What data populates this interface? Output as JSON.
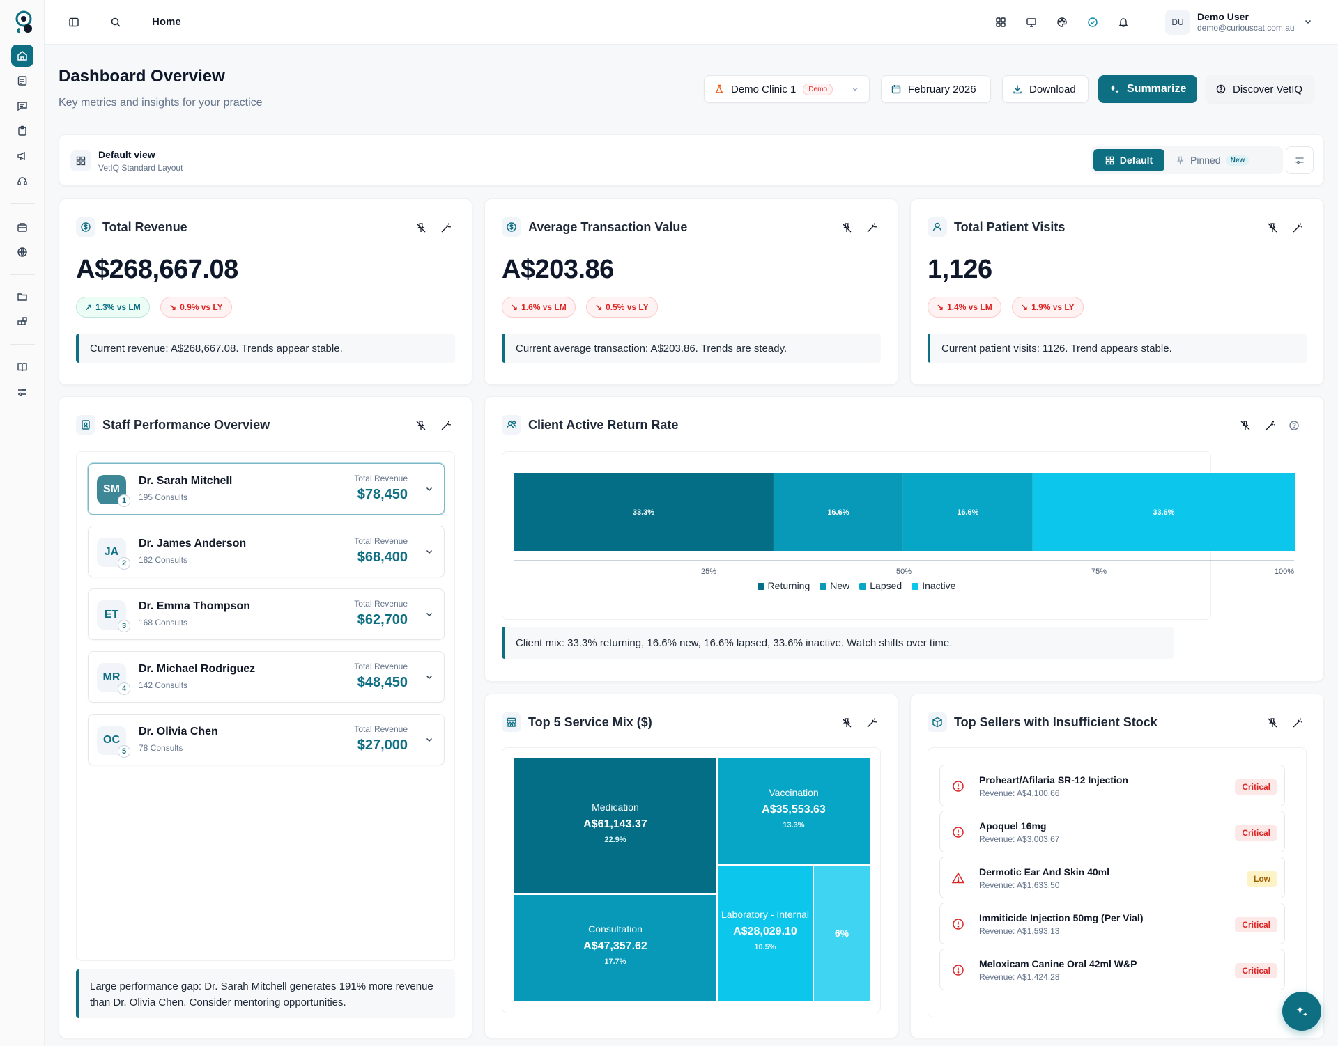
{
  "topbar": {
    "breadcrumb": "Home",
    "user": {
      "initials": "DU",
      "name": "Demo User",
      "email": "demo@curiouscat.com.au"
    }
  },
  "header": {
    "title": "Dashboard Overview",
    "subtitle": "Key metrics and insights for your practice",
    "clinic": "Demo Clinic 1",
    "clinic_badge": "Demo",
    "period": "February 2026",
    "download": "Download",
    "summarize": "Summarize",
    "discover": "Discover VetIQ"
  },
  "view": {
    "title": "Default view",
    "subtitle": "VetIQ Standard Layout",
    "default_label": "Default",
    "pinned_label": "Pinned",
    "new_badge": "New"
  },
  "kpis": [
    {
      "title": "Total Revenue",
      "value": "A$268,667.08",
      "pill1": "1.3% vs LM",
      "pill1_dir": "up",
      "pill2": "0.9% vs LY",
      "pill2_dir": "down",
      "insight": "Current revenue: A$268,667.08. Trends appear stable."
    },
    {
      "title": "Average Transaction Value",
      "value": "A$203.86",
      "pill1": "1.6% vs LM",
      "pill1_dir": "down",
      "pill2": "0.5% vs LY",
      "pill2_dir": "down",
      "insight": "Current average transaction: A$203.86. Trends are steady."
    },
    {
      "title": "Total Patient Visits",
      "value": "1,126",
      "pill1": "1.4% vs LM",
      "pill1_dir": "down",
      "pill2": "1.9% vs LY",
      "pill2_dir": "down",
      "insight": "Current patient visits: 1126. Trend appears stable."
    }
  ],
  "staff": {
    "title": "Staff Performance Overview",
    "revenue_label": "Total Revenue",
    "rows": [
      {
        "initials": "SM",
        "rank": "1",
        "name": "Dr. Sarah Mitchell",
        "consults": "195 Consults",
        "revenue": "$78,450"
      },
      {
        "initials": "JA",
        "rank": "2",
        "name": "Dr. James Anderson",
        "consults": "182 Consults",
        "revenue": "$68,400"
      },
      {
        "initials": "ET",
        "rank": "3",
        "name": "Dr. Emma Thompson",
        "consults": "168 Consults",
        "revenue": "$62,700"
      },
      {
        "initials": "MR",
        "rank": "4",
        "name": "Dr. Michael Rodriguez",
        "consults": "142 Consults",
        "revenue": "$48,450"
      },
      {
        "initials": "OC",
        "rank": "5",
        "name": "Dr. Olivia Chen",
        "consults": "78 Consults",
        "revenue": "$27,000"
      }
    ],
    "insight": "Large performance gap: Dr. Sarah Mitchell generates 191% more revenue than Dr. Olivia Chen. Consider mentoring opportunities."
  },
  "client_rate": {
    "title": "Client Active Return Rate",
    "insight": "Client mix: 33.3% returning, 16.6% new, 16.6% lapsed, 33.6% inactive. Watch shifts over time."
  },
  "service_mix": {
    "title": "Top 5 Service Mix ($)",
    "tiles": [
      {
        "name": "Medication",
        "amount": "A$61,143.37",
        "pct": "22.9%"
      },
      {
        "name": "Vaccination",
        "amount": "A$35,553.63",
        "pct": "13.3%"
      },
      {
        "name": "Consultation",
        "amount": "A$47,357.62",
        "pct": "17.7%"
      },
      {
        "name": "Laboratory - Internal",
        "amount": "A$28,029.10",
        "pct": "10.5%"
      },
      {
        "name": "",
        "amount": "",
        "pct": "6%"
      }
    ]
  },
  "stock": {
    "title": "Top Sellers with Insufficient Stock",
    "items": [
      {
        "name": "Proheart/Afilaria SR-12 Injection",
        "revenue": "Revenue: A$4,100.66",
        "status": "Critical",
        "level": "critical"
      },
      {
        "name": "Apoquel 16mg",
        "revenue": "Revenue: A$3,003.67",
        "status": "Critical",
        "level": "critical"
      },
      {
        "name": "Dermotic Ear And Skin 40ml",
        "revenue": "Revenue: A$1,633.50",
        "status": "Low",
        "level": "low"
      },
      {
        "name": "Immiticide Injection 50mg (Per Vial)",
        "revenue": "Revenue: A$1,593.13",
        "status": "Critical",
        "level": "critical"
      },
      {
        "name": "Meloxicam Canine Oral 42ml W&P",
        "revenue": "Revenue: A$1,424.28",
        "status": "Critical",
        "level": "critical"
      }
    ]
  },
  "colors": {
    "brand": "#0e6f83",
    "returning": "#036e85",
    "new": "#0799b7",
    "lapsed": "#07a6c6",
    "inactive": "#0cc6ec"
  },
  "chart_data": [
    {
      "type": "bar",
      "orientation": "horizontal-stacked",
      "categories": [
        "Returning",
        "New",
        "Lapsed",
        "Inactive"
      ],
      "values": [
        33.3,
        16.6,
        16.6,
        33.6
      ],
      "labels": [
        "33.3%",
        "16.6%",
        "16.6%",
        "33.6%"
      ],
      "xticks": [
        "25%",
        "50%",
        "75%",
        "100%"
      ],
      "xlim": [
        0,
        100
      ],
      "legend": "bottom"
    },
    {
      "type": "treemap",
      "categories": [
        "Medication",
        "Consultation",
        "Vaccination",
        "Laboratory - Internal",
        ""
      ],
      "values": [
        61143.37,
        47357.62,
        35553.63,
        28029.1,
        16000
      ],
      "percent": [
        22.9,
        17.7,
        13.3,
        10.5,
        6
      ]
    }
  ]
}
